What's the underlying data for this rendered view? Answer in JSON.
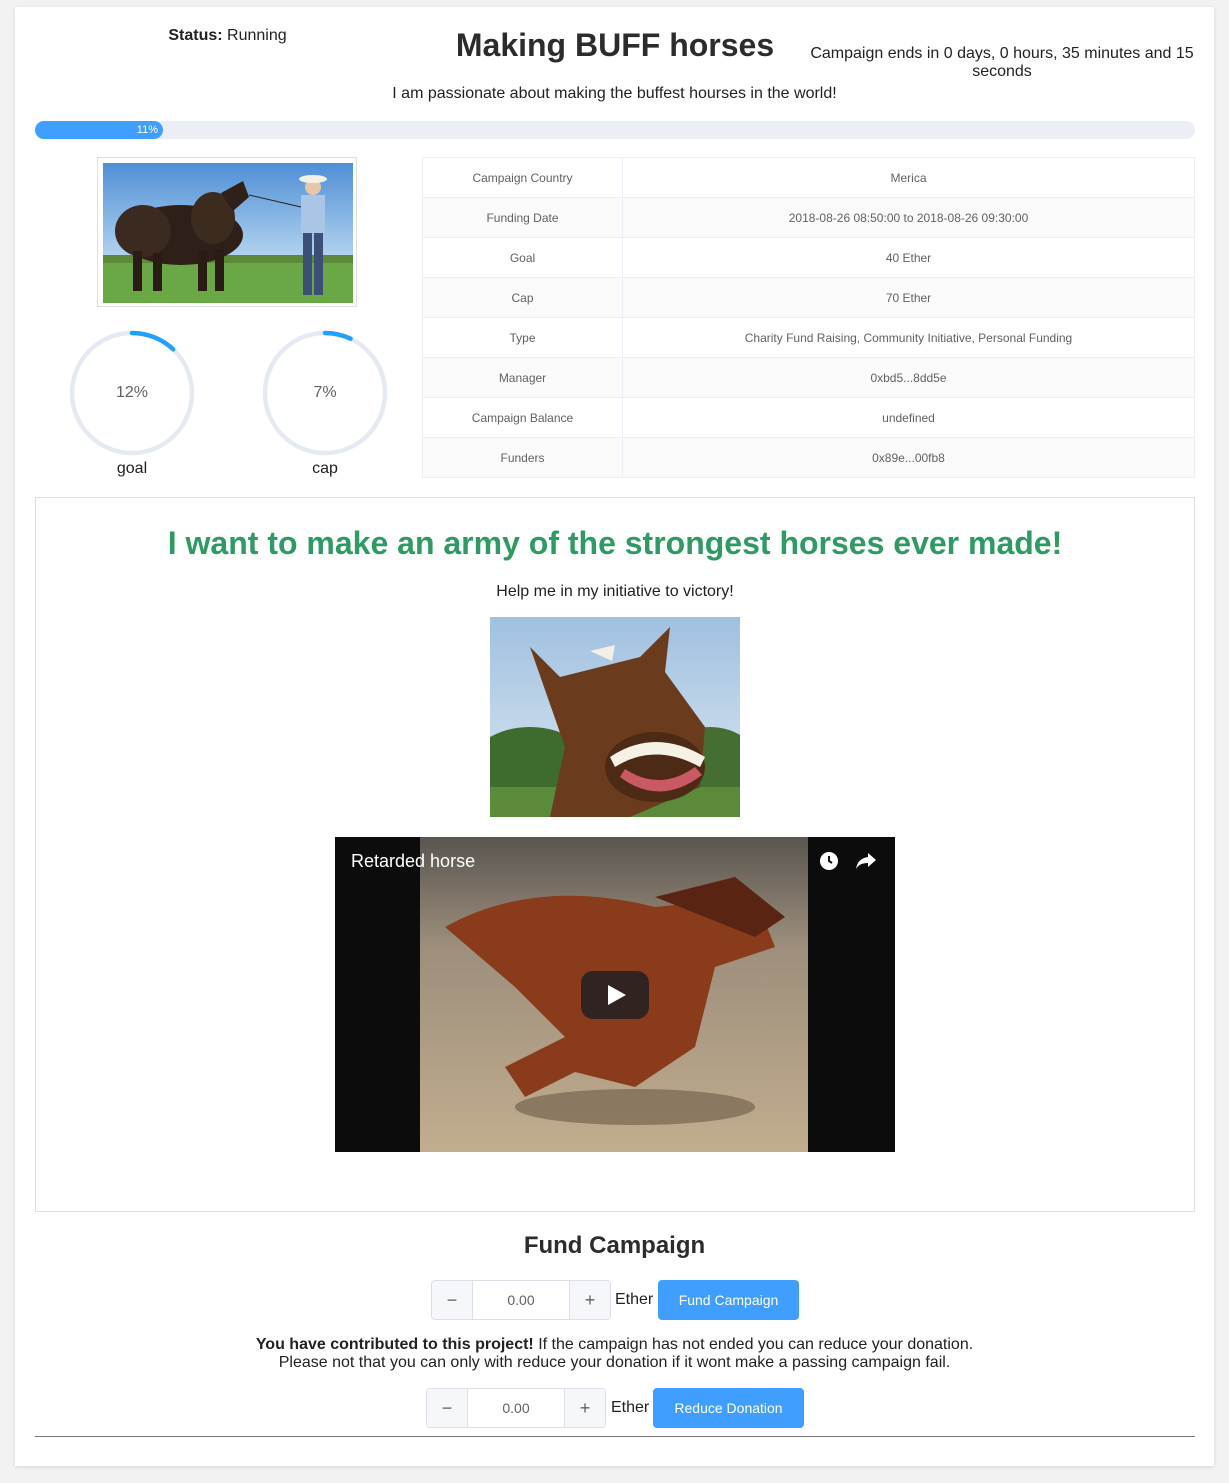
{
  "header": {
    "status_label": "Status:",
    "status_value": "Running",
    "title": "Making BUFF horses",
    "countdown_line1": "Campaign ends in 0 days, 0 hours, 35 minutes and 15",
    "countdown_line2": "seconds",
    "description": "I am passionate about making the buffest hourses in the world!"
  },
  "progress": {
    "value": 0.11,
    "label": "11%",
    "color": "#409eff"
  },
  "rings": [
    {
      "value": 0.12,
      "text": "12%",
      "label": "goal"
    },
    {
      "value": 0.07,
      "text": "7%",
      "label": "cap"
    }
  ],
  "info_table": [
    {
      "key": "Campaign Country",
      "value": "Merica"
    },
    {
      "key": "Funding Date",
      "value": "2018-08-26 08:50:00 to 2018-08-26 09:30:00"
    },
    {
      "key": "Goal",
      "value": "40 Ether"
    },
    {
      "key": "Cap",
      "value": "70 Ether"
    },
    {
      "key": "Type",
      "value": "Charity Fund Raising, Community Initiative, Personal Funding"
    },
    {
      "key": "Manager",
      "value": "0xbd5...8dd5e"
    },
    {
      "key": "Campaign Balance",
      "value": "undefined"
    },
    {
      "key": "Funders",
      "value": "0x89e...00fb8"
    }
  ],
  "story": {
    "heading": "I want to make an army of the strongest horses ever made!",
    "heading_color": "#2e9a64",
    "paragraph": "Help me in my initiative to victory!",
    "video_title": "Retarded horse"
  },
  "fund": {
    "title": "Fund Campaign",
    "amount": "0.00",
    "unit": "Ether",
    "button": "Fund Campaign"
  },
  "reduce": {
    "notice_bold": "You have contributed to this project!",
    "notice_rest": " If the campaign has not ended you can reduce your donation.",
    "notice_line2": "Please not that you can only with reduce your donation if it wont make a passing campaign fail.",
    "amount": "0.00",
    "unit": "Ether",
    "button": "Reduce Donation"
  },
  "icons": {
    "minus": "−",
    "plus": "+"
  }
}
